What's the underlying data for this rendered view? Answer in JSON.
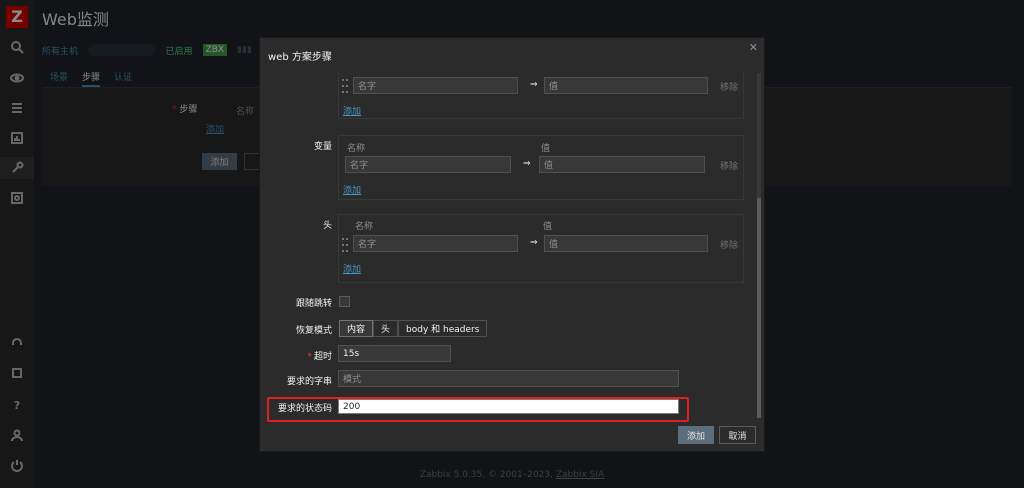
{
  "app": {
    "logo_letter": "Z",
    "page_title": "Web监测"
  },
  "breadcrumbs": {
    "all_hosts": "所有主机",
    "enabled": "已启用",
    "zbx": "ZBX"
  },
  "tabs": [
    {
      "label": "场景"
    },
    {
      "label": "步骤"
    },
    {
      "label": "认证"
    }
  ],
  "background_form": {
    "steps_label": "步骤",
    "name_col": "名称",
    "add_link": "添加",
    "add_button": "添加"
  },
  "modal": {
    "title": "web 方案步骤",
    "query_fields": {
      "name_placeholder": "名字",
      "value_placeholder": "值",
      "remove": "移除",
      "add": "添加"
    },
    "variables": {
      "label": "变量",
      "col_name": "名称",
      "col_value": "值",
      "name_placeholder": "名字",
      "value_placeholder": "值",
      "remove": "移除",
      "add": "添加"
    },
    "headers": {
      "label": "头",
      "col_name": "名称",
      "col_value": "值",
      "name_placeholder": "名字",
      "value_placeholder": "值",
      "remove": "移除",
      "add": "添加"
    },
    "follow_redirects": {
      "label": "跟随跳转",
      "checked": false
    },
    "retrieve_mode": {
      "label": "恢复模式",
      "options": [
        "内容",
        "头",
        "body 和 headers"
      ],
      "selected": "内容"
    },
    "timeout": {
      "label": "超时",
      "value": "15s"
    },
    "required_string": {
      "label": "要求的字串",
      "placeholder": "模式"
    },
    "required_status_codes": {
      "label": "要求的状态码",
      "value": "200"
    },
    "buttons": {
      "add": "添加",
      "cancel": "取消"
    }
  },
  "footer": {
    "text": "Zabbix 5.0.35. © 2001–2023, ",
    "company": "Zabbix SIA"
  },
  "colors": {
    "accent_link": "#4796c4",
    "highlight_border": "#e02020",
    "logo_red": "#d40000",
    "enabled_green": "#59db8f"
  }
}
